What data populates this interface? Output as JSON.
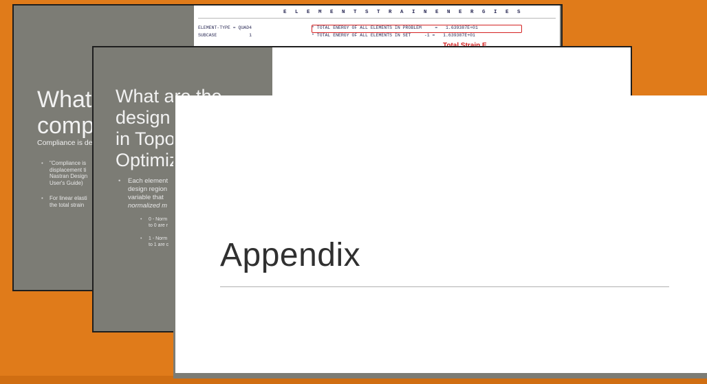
{
  "slide1": {
    "title_lines": [
      "What is",
      "compli"
    ],
    "subtitle": "Compliance is de",
    "bullets": [
      [
        "\"Compliance is",
        "displacement ti",
        "Nastran Design",
        "User's Guide)"
      ],
      [
        "For linear elasti",
        "the total strain"
      ]
    ],
    "strain_panel": {
      "heading": "E L E M E N T   S T R A I N   E N E R G I E S",
      "row1_left": "ELEMENT-TYPE = QUAD4",
      "row1_right": "* TOTAL ENERGY OF ALL ELEMENTS IN PROBLEM     =   1.639387E+01",
      "row2_left": "SUBCASE            1",
      "row2_right": "* TOTAL ENERGY OF ALL ELEMENTS IN SET     -1 =   1.639387E+01",
      "annotation": "Total Strain E"
    }
  },
  "slide2": {
    "title_lines": [
      "What are the",
      "design v",
      "in Topo",
      "Optimiz"
    ],
    "bullet_lines": [
      "Each element",
      "design region",
      "variable that",
      "normalized m"
    ],
    "subbullets": [
      [
        "0 - Norm",
        "to 0 are r"
      ],
      [
        "1 - Norm",
        "to 1 are c"
      ]
    ]
  },
  "slide3": {
    "title": "Appendix"
  },
  "colors": {
    "background": "#e07b1a",
    "slide_gray": "#7c7c75",
    "annotation_red": "#d42020"
  }
}
